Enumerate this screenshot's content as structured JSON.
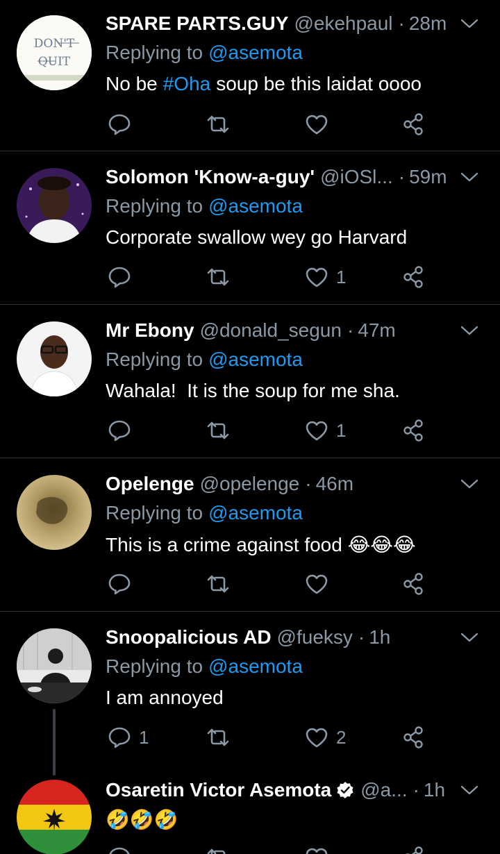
{
  "tweets": [
    {
      "name": "SPARE PARTS.GUY",
      "handle": "@ekehpaul",
      "time": "28m",
      "replying_label": "Replying to",
      "reply_to": "@asemota",
      "text_before": "No be",
      "hashtag": "#Oha",
      "text_after": "soup be this laidat oooo",
      "reply_count": "",
      "retweet_count": "",
      "like_count": "",
      "avatar_text_1": "DON'T",
      "avatar_text_2": "QUIT"
    },
    {
      "name": "Solomon 'Know-a-guy'",
      "handle": "@iOSl...",
      "time": "59m",
      "replying_label": "Replying to",
      "reply_to": "@asemota",
      "text": "Corporate swallow wey go Harvard",
      "reply_count": "",
      "retweet_count": "",
      "like_count": "1"
    },
    {
      "name": "Mr Ebony",
      "handle": "@donald_segun",
      "time": "47m",
      "replying_label": "Replying to",
      "reply_to": "@asemota",
      "text": "Wahala!  It is the soup for me sha.",
      "reply_count": "",
      "retweet_count": "",
      "like_count": "1"
    },
    {
      "name": "Opelenge",
      "handle": "@opelenge",
      "time": "46m",
      "replying_label": "Replying to",
      "reply_to": "@asemota",
      "text": "This is a crime against food 😂😂😂",
      "reply_count": "",
      "retweet_count": "",
      "like_count": ""
    },
    {
      "name": "Snoopalicious AD",
      "handle": "@fueksy",
      "time": "1h",
      "replying_label": "Replying to",
      "reply_to": "@asemota",
      "text": "I am annoyed",
      "reply_count": "1",
      "retweet_count": "",
      "like_count": "2"
    },
    {
      "name": "Osaretin Victor Asemota",
      "handle": "@a...",
      "time": "1h",
      "text": "🤣🤣🤣",
      "verified": true
    }
  ],
  "colors": {
    "background": "#000000",
    "text": "#ffffff",
    "muted": "#8b98a5",
    "link": "#1d9bf0",
    "divider": "#2f3336"
  },
  "icons": [
    "reply-icon",
    "retweet-icon",
    "like-icon",
    "share-icon",
    "caret-down-icon",
    "verified-icon"
  ]
}
